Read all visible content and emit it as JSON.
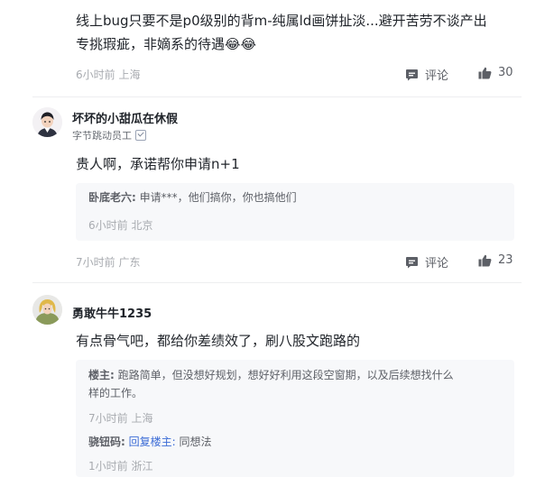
{
  "comment1": {
    "text_line1": "线上bug只要不是p0级别的背m-纯属ld画饼扯淡...避开苦劳不谈产出",
    "text_line2": "专挑瑕疵，非嫡系的待遇😂😂",
    "time": "6小时前",
    "location": "上海",
    "comment_label": "评论",
    "likes": "30"
  },
  "comment2": {
    "username": "坏坏的小甜瓜在休假",
    "subtitle": "字节跳动员工",
    "text": "贵人啊，承诺帮你申请n+1",
    "replies": [
      {
        "name": "卧底老六:",
        "text": "申请***，他们搞你，你也搞他们",
        "time": "6小时前",
        "location": "北京"
      }
    ],
    "time": "7小时前",
    "location": "广东",
    "comment_label": "评论",
    "likes": "23"
  },
  "comment3": {
    "username": "勇敢牛牛1235",
    "text": "有点骨气吧，都给你差绩效了，刷八股文跑路的",
    "replies": [
      {
        "name": "楼主:",
        "text_line1": "跑路简单，但没想好规划，想好好利用这段空窗期，以及后续想找什么",
        "text_line2": "样的工作。",
        "time": "7小时前",
        "location": "上海"
      },
      {
        "name": "骁钮码:",
        "link": "回复楼主:",
        "text": "同想法",
        "time": "1小时前",
        "location": "浙江"
      }
    ]
  }
}
